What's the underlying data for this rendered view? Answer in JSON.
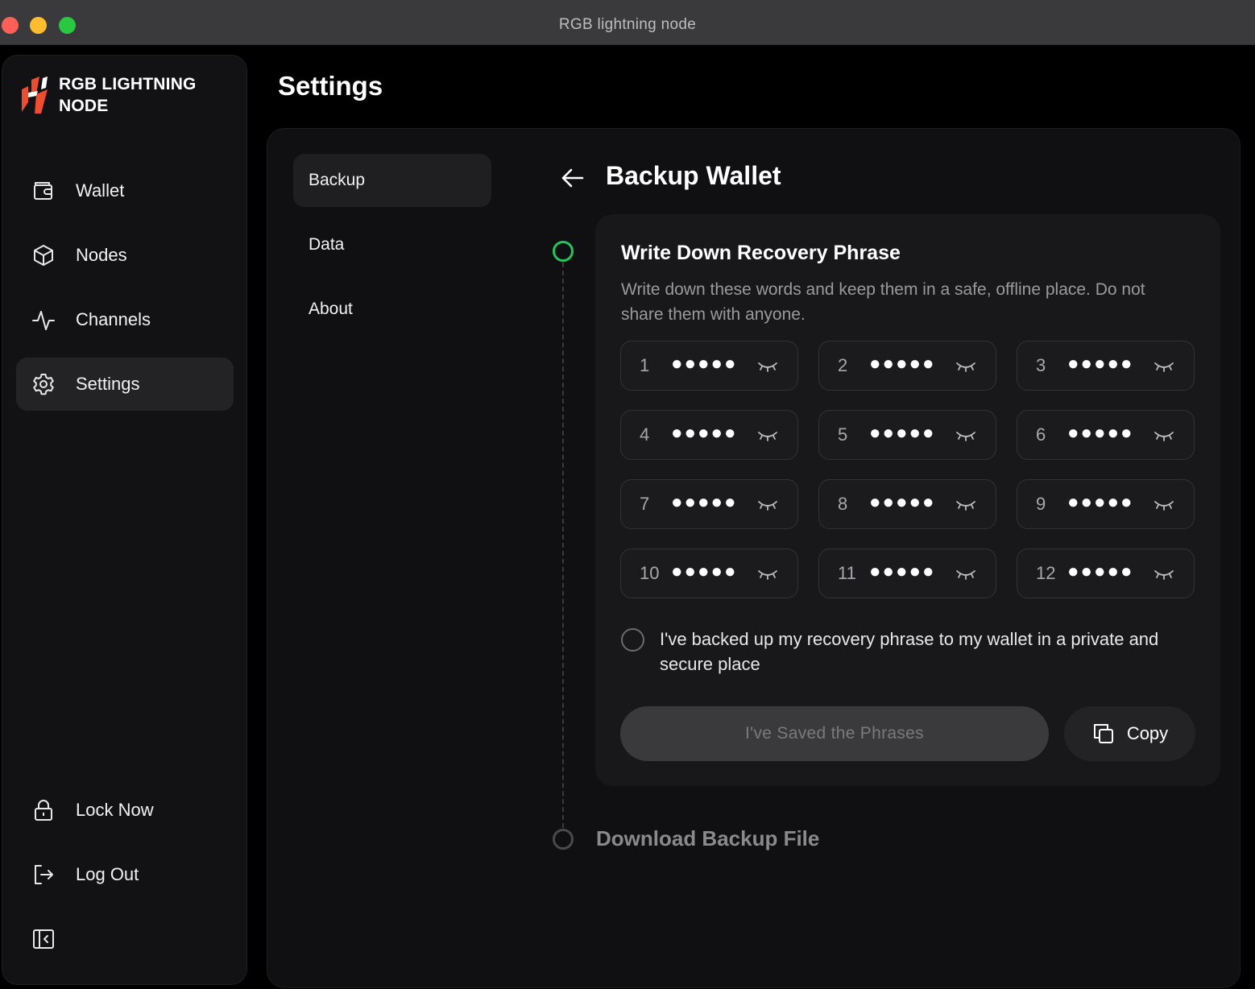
{
  "window": {
    "title": "RGB lightning node"
  },
  "brand": {
    "line1": "RGB LIGHTNING",
    "line2": "NODE",
    "logo_icon": "lightning-logo-icon",
    "accent": "#ef4d2d"
  },
  "sidebar": {
    "items": [
      {
        "label": "Wallet",
        "icon": "wallet-icon"
      },
      {
        "label": "Nodes",
        "icon": "cube-icon"
      },
      {
        "label": "Channels",
        "icon": "activity-icon"
      },
      {
        "label": "Settings",
        "icon": "gear-icon",
        "active": true
      }
    ],
    "bottom": [
      {
        "label": "Lock Now",
        "icon": "lock-icon"
      },
      {
        "label": "Log Out",
        "icon": "logout-icon"
      },
      {
        "label": "",
        "icon": "collapse-sidebar-icon"
      }
    ]
  },
  "page": {
    "title": "Settings"
  },
  "subnav": {
    "items": [
      {
        "label": "Backup",
        "active": true
      },
      {
        "label": "Data"
      },
      {
        "label": "About"
      }
    ]
  },
  "backup": {
    "title": "Backup Wallet",
    "step1": {
      "title": "Write Down Recovery Phrase",
      "desc": "Write down these words and keep them in a safe, offline place. Do not share them with anyone.",
      "mask": "●●●●●",
      "words": [
        "1",
        "2",
        "3",
        "4",
        "5",
        "6",
        "7",
        "8",
        "9",
        "10",
        "11",
        "12"
      ],
      "checkbox_label": "I've backed up my recovery phrase to my wallet in a private and secure place",
      "saved_button": "I've Saved the Phrases",
      "copy_button": "Copy"
    },
    "step2": {
      "title": "Download Backup File"
    },
    "colors": {
      "step_active": "#22c55e",
      "step_inactive": "#4a4a4e"
    }
  }
}
